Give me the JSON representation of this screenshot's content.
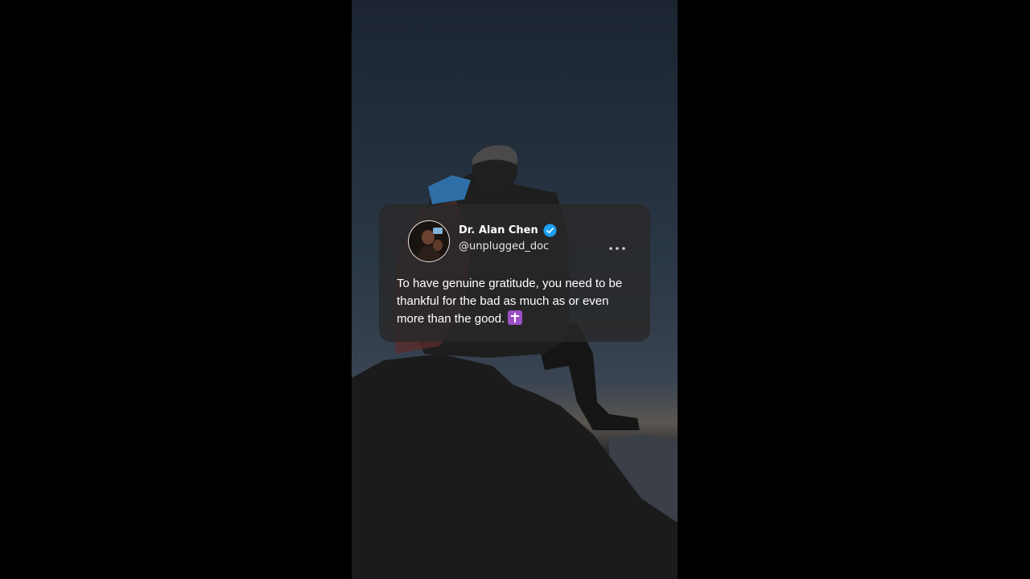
{
  "post": {
    "display_name": "Dr. Alan Chen",
    "handle": "@unplugged_doc",
    "text": "To have genuine gratitude, you need to be thankful for the bad as much as or even more than the good.",
    "emoji_icon": "latin-cross-emoji",
    "verified_icon": "verified-badge-icon",
    "more_icon": "more-options-icon"
  },
  "colors": {
    "card_background": "#282828",
    "verified_badge": "#1da1f2",
    "emoji_background": "#9b4fc4",
    "page_background": "#000000"
  }
}
